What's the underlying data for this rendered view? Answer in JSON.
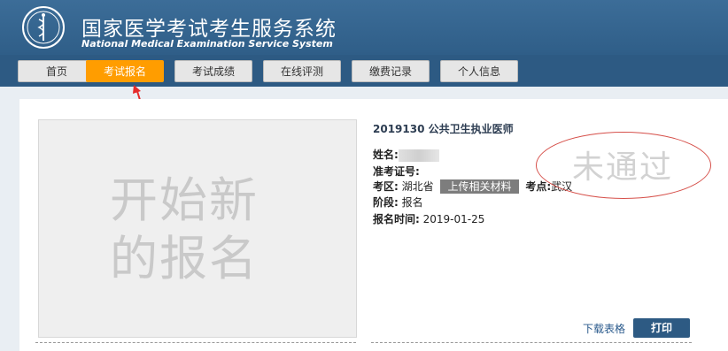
{
  "header": {
    "title": "国家医学考试考生服务系统",
    "subtitle": "National Medical Examination Service System"
  },
  "nav": {
    "items": [
      {
        "label": "首页",
        "active": false
      },
      {
        "label": "考试报名",
        "active": true
      },
      {
        "label": "考试成绩",
        "active": false
      },
      {
        "label": "在线评测",
        "active": false
      },
      {
        "label": "缴费记录",
        "active": false
      },
      {
        "label": "个人信息",
        "active": false
      }
    ]
  },
  "main": {
    "photo_placeholder": "开始新的报名",
    "exam_title": "2019130 公共卫生执业医师",
    "name_label": "姓名:",
    "admission_label": "准考证号:",
    "region_label": "考区:",
    "region_value": "湖北省",
    "upload_button": "上传相关材料",
    "site_label": "考点:",
    "site_value": "武汉",
    "stage_label": "阶段:",
    "stage_value": "报名",
    "time_label": "报名时间:",
    "time_value": "2019-01-25",
    "stamp_text": "未通过",
    "download_link": "下载表格",
    "print_button": "打印"
  },
  "colors": {
    "header_bg": "#3c6d98",
    "nav_bg": "#2d5a83",
    "active_tab": "#ff9d00",
    "stamp_border": "#d6504a"
  }
}
